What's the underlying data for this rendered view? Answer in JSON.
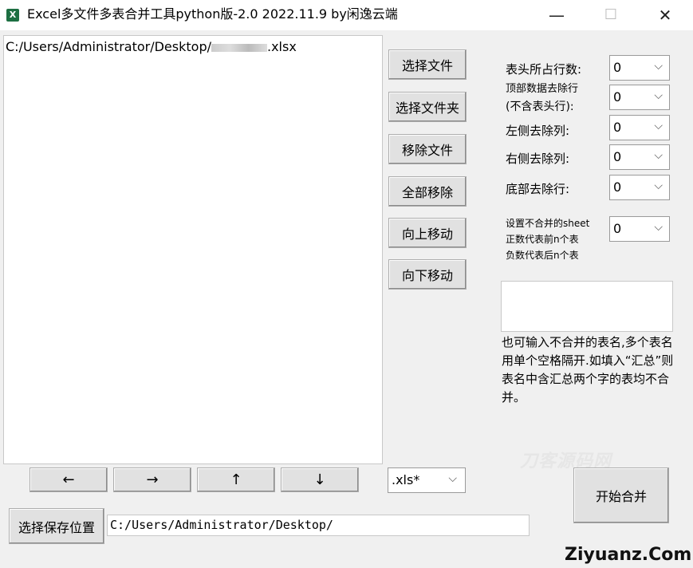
{
  "window": {
    "title": "Excel多文件多表合并工具python版-2.0 2022.11.9 by闲逸云端",
    "icon": "excel-icon",
    "controls": {
      "minimize": "—",
      "maximize": "☐",
      "close": "✕"
    }
  },
  "file_list": {
    "items": [
      {
        "prefix": "C:/Users/Administrator/Desktop/",
        "suffix": ".xlsx"
      }
    ]
  },
  "file_buttons": {
    "select_file": "选择文件",
    "select_folder": "选择文件夹",
    "remove_file": "移除文件",
    "remove_all": "全部移除",
    "move_up": "向上移动",
    "move_down": "向下移动"
  },
  "params": {
    "header_rows": {
      "label": "表头所占行数:",
      "value": "0"
    },
    "top_remove": {
      "label_line1": "顶部数据去除行",
      "label_line2": "(不含表头行):",
      "value": "0"
    },
    "left_remove": {
      "label": "左侧去除列:",
      "value": "0"
    },
    "right_remove": {
      "label": "右侧去除列:",
      "value": "0"
    },
    "bottom_remove": {
      "label": "底部去除行:",
      "value": "0"
    },
    "sheet_exclude": {
      "label_line1": "设置不合并的sheet",
      "label_line2": "正数代表前n个表",
      "label_line3": "负数代表后n个表",
      "value": "0"
    }
  },
  "hint": "也可输入不合并的表名,多个表名用单个空格隔开.如填入“汇总”则表名中含汇总两个字的表均不合并。",
  "arrows": {
    "left": "←",
    "right": "→",
    "up": "↑",
    "down": "↓"
  },
  "extension": {
    "value": ".xls*",
    "arrow": "⌵"
  },
  "merge_button": "开始合并",
  "save": {
    "button": "选择保存位置",
    "path": "C:/Users/Administrator/Desktop/"
  },
  "watermark": "刀客源码网",
  "site": "Ziyuanz.Com"
}
